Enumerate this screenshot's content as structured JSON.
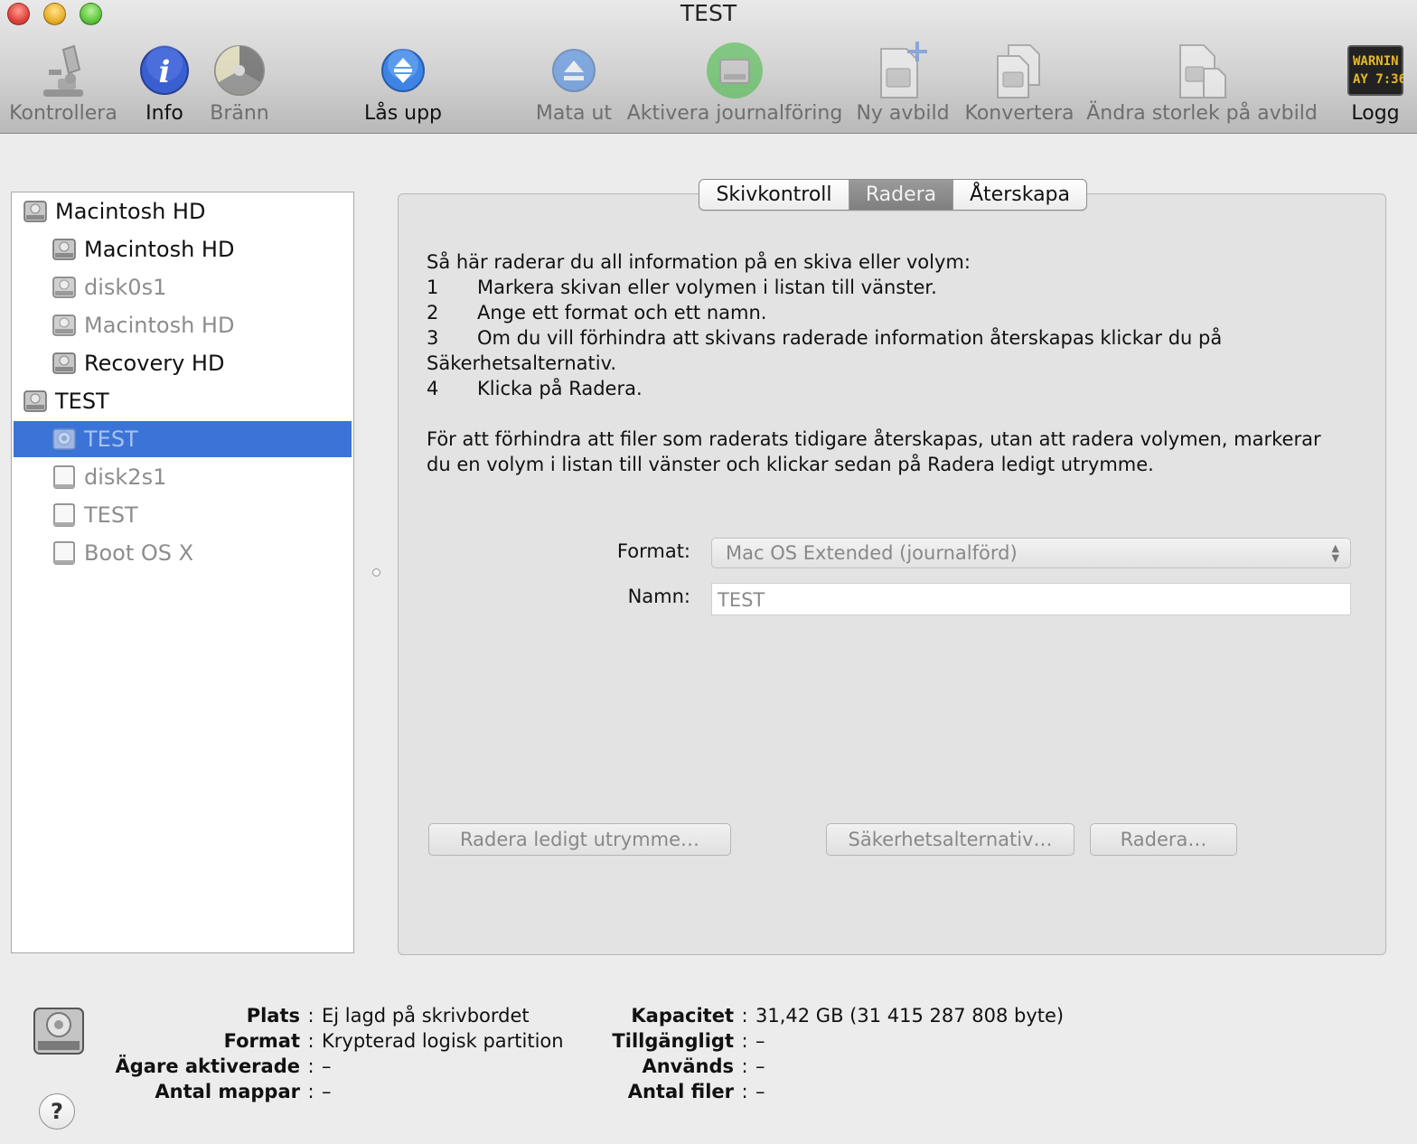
{
  "window": {
    "title": "TEST"
  },
  "toolbar": {
    "verify": "Kontrollera",
    "info": "Info",
    "burn": "Bränn",
    "unlock": "Lås upp",
    "eject": "Mata ut",
    "enable_journaling": "Aktivera journalföring",
    "new_image": "Ny avbild",
    "convert": "Konvertera",
    "resize_image": "Ändra storlek på avbild",
    "log": "Logg",
    "log_screen_line1": "WARNIN",
    "log_screen_line2": "AY 7:36"
  },
  "sidebar": {
    "items": [
      {
        "label": "Macintosh HD"
      },
      {
        "label": "Macintosh HD"
      },
      {
        "label": "disk0s1"
      },
      {
        "label": "Macintosh HD"
      },
      {
        "label": "Recovery HD"
      },
      {
        "label": "TEST"
      },
      {
        "label": "TEST"
      },
      {
        "label": "disk2s1"
      },
      {
        "label": "TEST"
      },
      {
        "label": "Boot OS X"
      }
    ]
  },
  "tabs": {
    "first_aid": "Skivkontroll",
    "erase": "Radera",
    "restore": "Återskapa"
  },
  "erase": {
    "intro": "Så här raderar du all information på en skiva eller volym:",
    "steps": [
      {
        "n": "1",
        "text": "Markera skivan eller volymen i listan till vänster."
      },
      {
        "n": "2",
        "text": "Ange ett format och ett namn."
      },
      {
        "n": "3",
        "text": "Om du vill förhindra att skivans raderade information återskapas klickar du på"
      },
      {
        "n": "",
        "text": "Säkerhetsalternativ."
      },
      {
        "n": "4",
        "text": "Klicka på Radera."
      }
    ],
    "note_line1": "För att förhindra att filer som raderats tidigare återskapas, utan att radera volymen, markerar",
    "note_line2": "du en volym i listan till vänster och klickar sedan på Radera ledigt utrymme.",
    "format_label": "Format:",
    "format_value": "Mac OS Extended (journalförd)",
    "name_label": "Namn:",
    "name_value": "TEST",
    "erase_free_space": "Radera ledigt utrymme…",
    "security_options": "Säkerhetsalternativ…",
    "erase_button": "Radera…"
  },
  "info": {
    "location_label": "Plats",
    "location_value": "Ej lagd på skrivbordet",
    "format_label": "Format",
    "format_value": "Krypterad logisk partition",
    "owners_label": "Ägare aktiverade",
    "owners_value": "–",
    "folders_label": "Antal mappar",
    "folders_value": "–",
    "capacity_label": "Kapacitet",
    "capacity_value": "31,42 GB (31 415 287 808 byte)",
    "available_label": "Tillgängligt",
    "available_value": "–",
    "used_label": "Används",
    "used_value": "–",
    "files_label": "Antal filer",
    "files_value": "–",
    "colon": ":",
    "help": "?"
  }
}
